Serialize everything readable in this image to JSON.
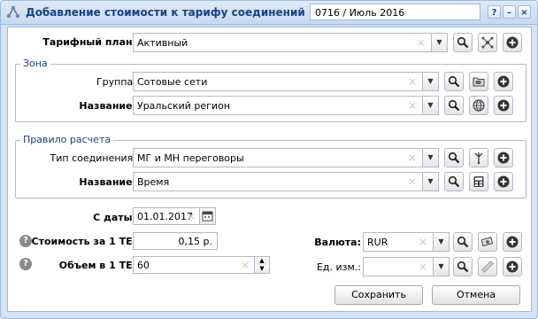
{
  "window": {
    "title": "Добавление стоимости к тарифу соединений",
    "period": "0716 / Июль 2016",
    "help_label": "?",
    "minimize_label": "–",
    "close_label": "×"
  },
  "tariff": {
    "label": "Тарифный план:",
    "value": "Активный"
  },
  "zone": {
    "legend": "Зона",
    "group_label": "Группа:",
    "group_value": "Сотовые сети",
    "name_label": "Название:",
    "name_value": "Уральский регион"
  },
  "rule": {
    "legend": "Правило расчета",
    "conn_type_label": "Тип соединения:",
    "conn_type_value": "МГ и МН переговоры",
    "name_label": "Название:",
    "name_value": "Время"
  },
  "date": {
    "label": "С даты:",
    "value": "01.01.2017"
  },
  "cost": {
    "label": "Стоимость за 1 ТЕ:",
    "value": "0,15 р."
  },
  "volume": {
    "label": "Объем в 1 ТЕ:",
    "value": "60"
  },
  "currency": {
    "label": "Валюта:",
    "value": "RUR"
  },
  "unit": {
    "label": "Ед. изм.:",
    "value": ""
  },
  "buttons": {
    "save": "Сохранить",
    "cancel": "Отмена"
  },
  "icons": {
    "search": "search-icon",
    "add": "add-icon",
    "network": "network-icon",
    "folder": "folder-icon",
    "globe": "globe-icon",
    "fork": "fork-icon",
    "calculator": "calculator-icon",
    "money": "money-icon",
    "ruler": "ruler-icon",
    "calendar": "calendar-icon",
    "help": "help-icon"
  }
}
